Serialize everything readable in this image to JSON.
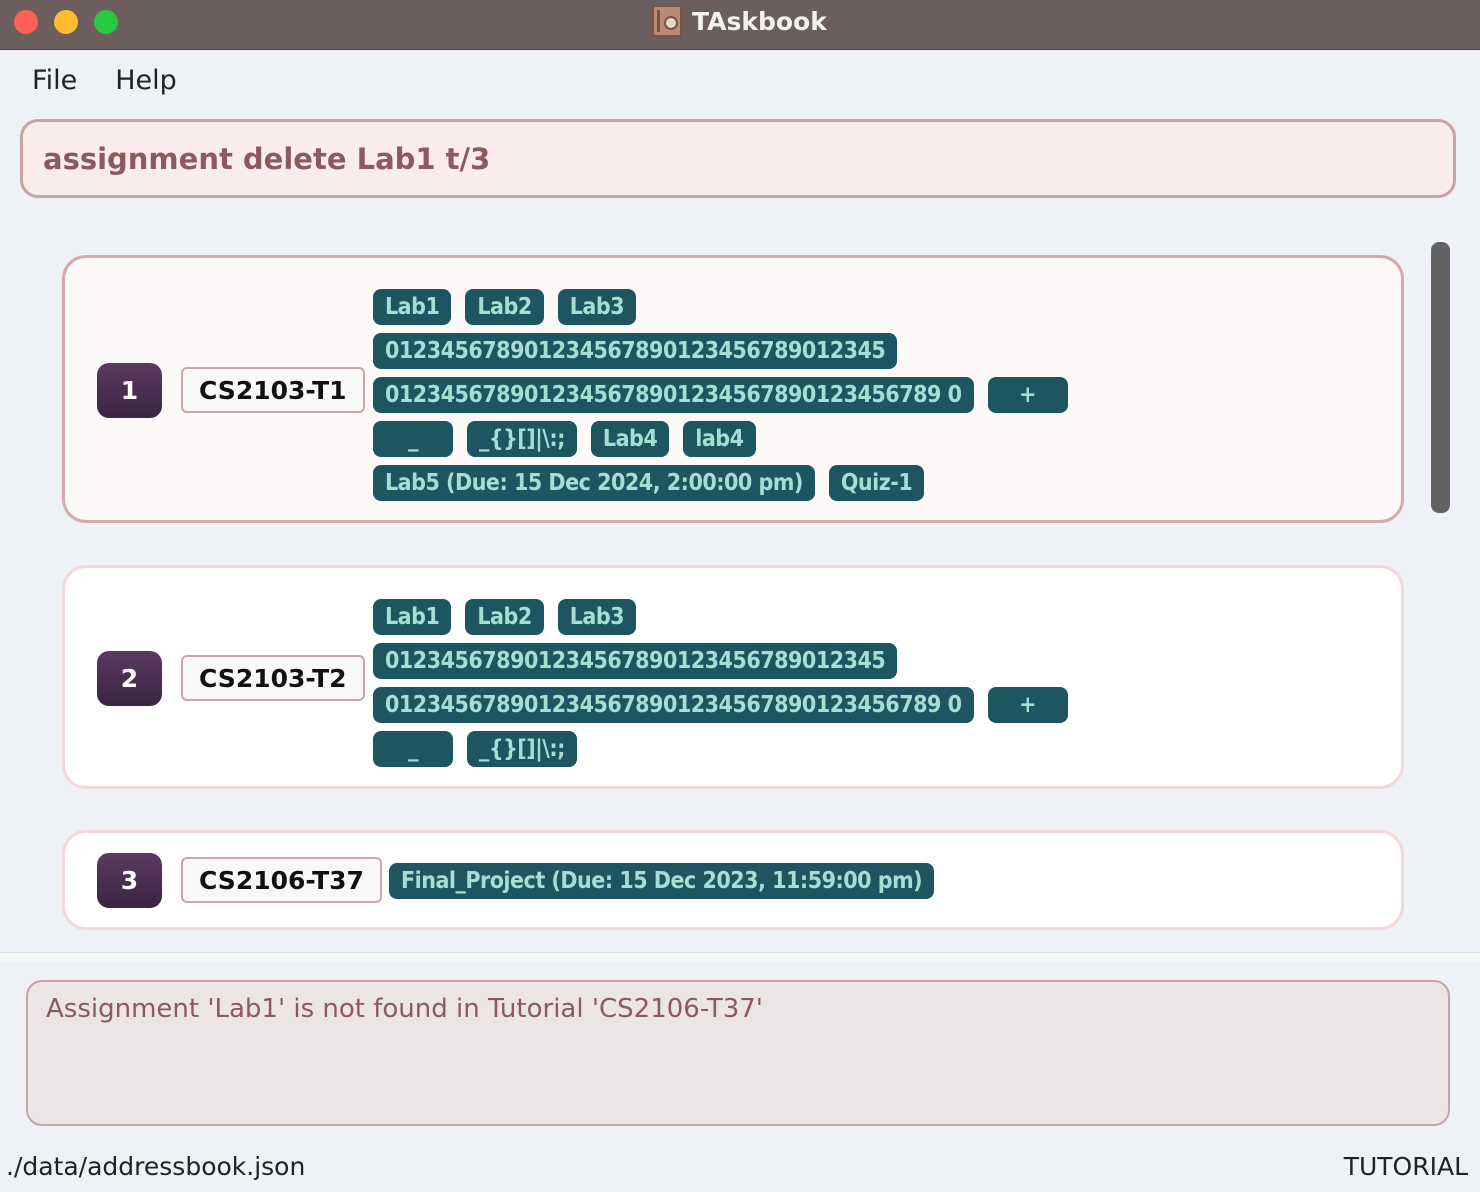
{
  "window": {
    "title": "TAskbook"
  },
  "menu": {
    "file": "File",
    "help": "Help"
  },
  "command": {
    "value": "assignment delete Lab1 t/3"
  },
  "tutorials": [
    {
      "index": "1",
      "code": "CS2103-T1",
      "tags": [
        [
          "Lab1",
          "Lab2",
          "Lab3"
        ],
        [
          "012345678901234567890123456789012345"
        ],
        [
          "0123456789012345678901234567890123456789 0",
          "+"
        ],
        [
          "_",
          "_{}[]|\\:;",
          "Lab4",
          "lab4"
        ],
        [
          "Lab5 (Due: 15 Dec 2024, 2:00:00 pm)",
          "Quiz-1"
        ]
      ]
    },
    {
      "index": "2",
      "code": "CS2103-T2",
      "tags": [
        [
          "Lab1",
          "Lab2",
          "Lab3"
        ],
        [
          "012345678901234567890123456789012345"
        ],
        [
          "0123456789012345678901234567890123456789 0",
          "+"
        ],
        [
          "_",
          "_{}[]|\\:;"
        ]
      ]
    },
    {
      "index": "3",
      "code": "CS2106-T37",
      "tags": [
        [
          "Final_Project (Due: 15 Dec 2023, 11:59:00 pm)"
        ]
      ]
    }
  ],
  "result": {
    "message": "Assignment 'Lab1' is not found in Tutorial 'CS2106-T37'"
  },
  "status": {
    "path": "./data/addressbook.json",
    "mode": "TUTORIAL"
  }
}
